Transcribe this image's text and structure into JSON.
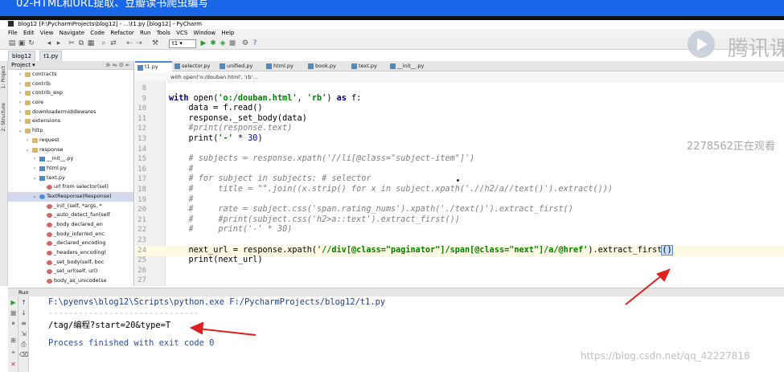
{
  "video": {
    "title": "02-HTML和URL提取、豆瓣读书爬虫编写"
  },
  "window": {
    "title": "blog12 [F:\\PycharmProjects\\blog12] - ...\\t1.py [blog12] - PyCharm"
  },
  "menu": [
    "File",
    "Edit",
    "View",
    "Navigate",
    "Code",
    "Refactor",
    "Run",
    "Tools",
    "VCS",
    "Window",
    "Help"
  ],
  "toolbar": {
    "run_config": "t1"
  },
  "breadcrumb": [
    "blog12",
    "t1.py"
  ],
  "left_strip": {
    "project": "1: Project",
    "structure": "2: Structure"
  },
  "project_panel": {
    "title": "Project"
  },
  "tree": [
    {
      "label": "contracts",
      "kind": "folder"
    },
    {
      "label": "contrib",
      "kind": "folder"
    },
    {
      "label": "contrib_exp",
      "kind": "folder"
    },
    {
      "label": "core",
      "kind": "folder"
    },
    {
      "label": "downloadermiddlewares",
      "kind": "folder"
    },
    {
      "label": "extensions",
      "kind": "folder"
    },
    {
      "label": "http",
      "kind": "folder"
    },
    {
      "label": "request",
      "kind": "folder"
    },
    {
      "label": "response",
      "kind": "folder"
    },
    {
      "label": "__init__.py",
      "kind": "py"
    },
    {
      "label": "html.py",
      "kind": "py"
    },
    {
      "label": "text.py",
      "kind": "py"
    },
    {
      "label": "url from selector(sel)",
      "kind": "method"
    },
    {
      "label": "TextResponse(Response)",
      "kind": "class"
    },
    {
      "label": "_init_(self, *args, *",
      "kind": "method"
    },
    {
      "label": "_auto_detect_fun(self",
      "kind": "method"
    },
    {
      "label": "_body declared_en",
      "kind": "method"
    },
    {
      "label": "_body_inferred_enc",
      "kind": "method"
    },
    {
      "label": "_declared_encoding",
      "kind": "method"
    },
    {
      "label": "_headers_encoding(",
      "kind": "method"
    },
    {
      "label": "_set_body(self, boc",
      "kind": "method"
    },
    {
      "label": "_set_url(self, url)",
      "kind": "method"
    },
    {
      "label": "body_as_unicode(se",
      "kind": "method"
    }
  ],
  "editor_tabs": [
    "t1.py",
    "selector.py",
    "unified.py",
    "html.py",
    "book.py",
    "text.py",
    "__init__.py"
  ],
  "editor_crumb": "with open('o:/douban.html', 'rb'...",
  "code": {
    "lines": [
      {
        "n": "8"
      },
      {
        "n": "9",
        "t": [
          {
            "c": "kw",
            "s": "with "
          },
          {
            "s": "open("
          },
          {
            "c": "str",
            "s": "'o:/douban.html'"
          },
          {
            "s": ", "
          },
          {
            "c": "str",
            "s": "'rb'"
          },
          {
            "s": ") "
          },
          {
            "c": "kw",
            "s": "as "
          },
          {
            "s": "f:"
          }
        ]
      },
      {
        "n": "10",
        "t": [
          {
            "s": "    data = f.read()"
          }
        ]
      },
      {
        "n": "11",
        "t": [
          {
            "s": "    response._set_body(data)"
          }
        ]
      },
      {
        "n": "12",
        "t": [
          {
            "c": "cmt",
            "s": "    #print(response.text)"
          }
        ]
      },
      {
        "n": "13",
        "t": [
          {
            "s": "    print("
          },
          {
            "c": "str",
            "s": "'-'"
          },
          {
            "s": " * "
          },
          {
            "c": "num",
            "s": "30"
          },
          {
            "s": ")"
          }
        ]
      },
      {
        "n": "14"
      },
      {
        "n": "15",
        "t": [
          {
            "c": "cmt",
            "s": "    # subjects = response.xpath('//li[@class=\"subject-item\"]')"
          }
        ]
      },
      {
        "n": "16",
        "t": [
          {
            "c": "cmt",
            "s": "    #"
          }
        ]
      },
      {
        "n": "17",
        "t": [
          {
            "c": "cmt",
            "s": "    # for subject in subjects: # selector"
          }
        ]
      },
      {
        "n": "18",
        "t": [
          {
            "c": "cmt",
            "s": "    #     title = \"\".join((x.strip() for x in subject.xpath('.//h2/a//text()').extract()))"
          }
        ]
      },
      {
        "n": "19",
        "t": [
          {
            "c": "cmt",
            "s": "    #"
          }
        ]
      },
      {
        "n": "20",
        "t": [
          {
            "c": "cmt",
            "s": "    #     rate = subject.css('span.rating_nums').xpath('./text()').extract_first()"
          }
        ]
      },
      {
        "n": "21",
        "t": [
          {
            "c": "cmt",
            "s": "    #     #print(subject.css('h2>a::text').extract_first())"
          }
        ]
      },
      {
        "n": "22",
        "t": [
          {
            "c": "cmt",
            "s": "    #     print('-' * 30)"
          }
        ]
      },
      {
        "n": "23"
      },
      {
        "n": "24",
        "t": [
          {
            "s": "    next_url = response.xpath("
          },
          {
            "c": "str",
            "s": "'//div[@class=\"paginator\"]/span[@class=\"next\"]/a/@href'"
          },
          {
            "s": ").extract_first"
          },
          {
            "c": "caret",
            "s": "()"
          }
        ]
      },
      {
        "n": "25",
        "t": [
          {
            "s": "    print(next_url)"
          }
        ]
      },
      {
        "n": "26"
      },
      {
        "n": "27"
      }
    ]
  },
  "run": {
    "header": "Run",
    "lines": [
      {
        "cls": "path",
        "text": "F:\\pyenvs\\blog12\\Scripts\\python.exe F:/PycharmProjects/blog12/t1.py"
      },
      {
        "cls": "sep",
        "text": "------------------------------"
      },
      {
        "cls": "plain",
        "text": "/tag/编程?start=20&type=T"
      },
      {
        "cls": "plain",
        "text": ""
      },
      {
        "cls": "done",
        "text": "Process finished with exit code 0"
      }
    ]
  },
  "watermark": {
    "brand": "腾讯课",
    "viewer": "2278562正在观看",
    "url": "https://blog.csdn.net/qq_42227818"
  },
  "colors": {
    "title_bar": "#1a66e8",
    "annotation": "#e02020",
    "keyword": "#000080",
    "string": "#008000",
    "comment": "#808080"
  }
}
